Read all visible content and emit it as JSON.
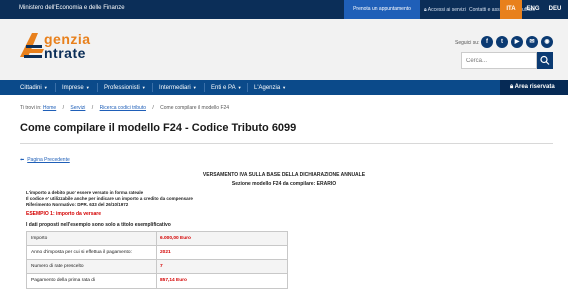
{
  "topbar": {
    "ministry": "Ministero dell'Economia e delle Finanze",
    "appointment": "Prenota un appuntamento",
    "links": [
      "Accessi ai servizi",
      "Contatti e assistenza",
      "Trova l'ufficio"
    ],
    "languages": [
      "ITA",
      "ENG",
      "DEU"
    ],
    "active_language": "ITA"
  },
  "header": {
    "logo_line1": "genzia",
    "logo_line2": "ntrate",
    "follow_label": "Seguici su:",
    "social": [
      {
        "icon": "facebook-icon",
        "glyph": "f"
      },
      {
        "icon": "twitter-icon",
        "glyph": "t"
      },
      {
        "icon": "youtube-icon",
        "glyph": "▶"
      },
      {
        "icon": "email-icon",
        "glyph": "✉"
      },
      {
        "icon": "rss-icon",
        "glyph": "◉"
      }
    ],
    "search_placeholder": "Cerca..."
  },
  "nav": {
    "items": [
      "Cittadini",
      "Imprese",
      "Professionisti",
      "Intermediari",
      "Enti e PA",
      "L'Agenzia"
    ],
    "reserved": "Area riservata"
  },
  "breadcrumb": {
    "prefix": "Ti trovi in:",
    "items": [
      "Home",
      "Servizi",
      "Ricerca codici tributo"
    ],
    "current": "Come compilare il modello F24"
  },
  "page": {
    "title": "Come compilare il modello F24 - Codice Tributo 6099",
    "back": "Pagina Precedente",
    "doc_title": "VERSAMENTO IVA SULLA BASE DELLA DICHIARAZIONE ANNUALE",
    "doc_subtitle": "Sezione modello F24 da compilare: ERARIO",
    "notes": [
      "L'importo a debito puo' essere versato in forma rateale",
      "Il codice e' utilizzabile anche per indicare un importo a credito da compensare",
      "Riferimento Normativo: DPR. 633 del 26/10/1972"
    ],
    "example": "ESEMPIO 1: importo da versare",
    "data_heading": "I dati proposti nell'esempio sono solo a titolo esemplificativo",
    "rows": [
      {
        "label": "Importo",
        "value": "6.000,00 Euro"
      },
      {
        "label": "Anno d'imposta per cui si effettua il pagamento:",
        "value": "2021"
      },
      {
        "label": "Numero di rate prescelto",
        "value": "7"
      },
      {
        "label": "Pagamento della prima rata di",
        "value": "857,14 Euro"
      }
    ]
  },
  "colors": {
    "topbar": "#0b2e58",
    "nav": "#0b4a8a",
    "accent": "#e8801c",
    "highlight_red": "#d40000",
    "link": "#1f5fb8"
  }
}
